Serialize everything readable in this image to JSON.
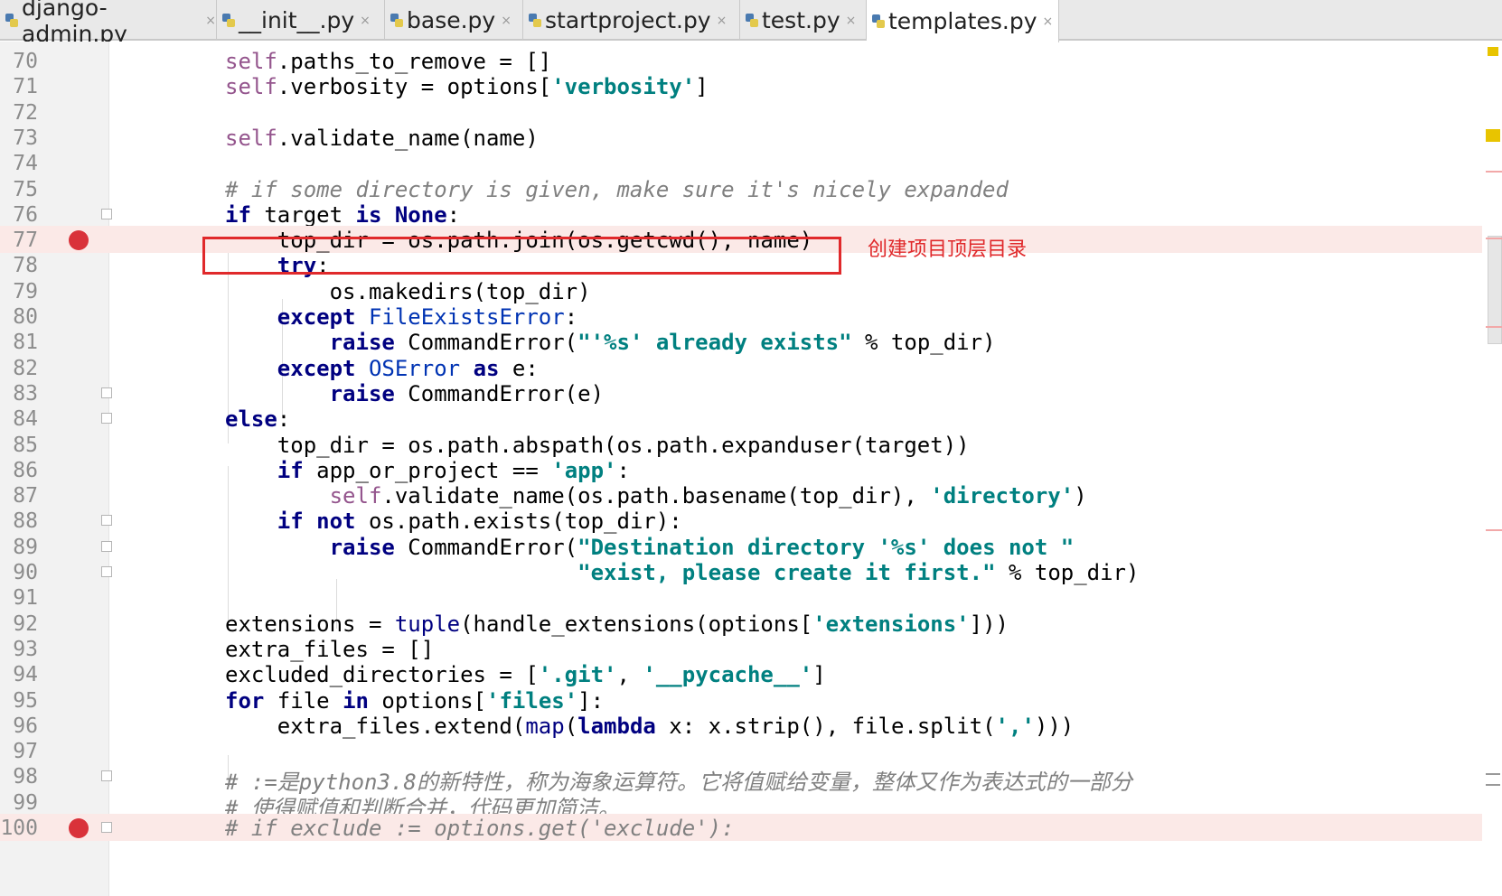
{
  "tabs": [
    {
      "label": "django-admin.py",
      "active": false
    },
    {
      "label": "__init__.py",
      "active": false
    },
    {
      "label": "base.py",
      "active": false
    },
    {
      "label": "startproject.py",
      "active": false
    },
    {
      "label": "test.py",
      "active": false
    },
    {
      "label": "templates.py",
      "active": true
    }
  ],
  "annotation": "创建项目顶层目录",
  "colors": {
    "breakpoint": "#d9323a",
    "highlight": "#e0292b",
    "keyword": "#000080",
    "string": "#008080",
    "self": "#94558d",
    "comment": "#808080"
  },
  "lines": [
    {
      "num": "70",
      "text": "self.paths_to_remove = []"
    },
    {
      "num": "71",
      "text": "self.verbosity = options['verbosity']"
    },
    {
      "num": "72",
      "text": ""
    },
    {
      "num": "73",
      "text": "self.validate_name(name)"
    },
    {
      "num": "74",
      "text": ""
    },
    {
      "num": "75",
      "text": "# if some directory is given, make sure it's nicely expanded"
    },
    {
      "num": "76",
      "text": "if target is None:"
    },
    {
      "num": "77",
      "text": "    top_dir = os.path.join(os.getcwd(), name)",
      "breakpoint": true
    },
    {
      "num": "78",
      "text": "    try:"
    },
    {
      "num": "79",
      "text": "        os.makedirs(top_dir)"
    },
    {
      "num": "80",
      "text": "    except FileExistsError:"
    },
    {
      "num": "81",
      "text": "        raise CommandError(\"'%s' already exists\" % top_dir)"
    },
    {
      "num": "82",
      "text": "    except OSError as e:"
    },
    {
      "num": "83",
      "text": "        raise CommandError(e)"
    },
    {
      "num": "84",
      "text": "else:"
    },
    {
      "num": "85",
      "text": "    top_dir = os.path.abspath(os.path.expanduser(target))"
    },
    {
      "num": "86",
      "text": "    if app_or_project == 'app':"
    },
    {
      "num": "87",
      "text": "        self.validate_name(os.path.basename(top_dir), 'directory')"
    },
    {
      "num": "88",
      "text": "    if not os.path.exists(top_dir):"
    },
    {
      "num": "89",
      "text": "        raise CommandError(\"Destination directory '%s' does not \""
    },
    {
      "num": "90",
      "text": "                           \"exist, please create it first.\" % top_dir)"
    },
    {
      "num": "91",
      "text": ""
    },
    {
      "num": "92",
      "text": "extensions = tuple(handle_extensions(options['extensions']))"
    },
    {
      "num": "93",
      "text": "extra_files = []"
    },
    {
      "num": "94",
      "text": "excluded_directories = ['.git', '__pycache__']"
    },
    {
      "num": "95",
      "text": "for file in options['files']:"
    },
    {
      "num": "96",
      "text": "    extra_files.extend(map(lambda x: x.strip(), file.split(',')))"
    },
    {
      "num": "97",
      "text": ""
    },
    {
      "num": "98",
      "text": "# :=是python3.8的新特性，称为海象运算符。它将值赋给变量，整体又作为表达式的一部分"
    },
    {
      "num": "99",
      "text": "# 使得赋值和判断合并，代码更加简洁。"
    },
    {
      "num": "100",
      "text": "# if exclude := options.get('exclude'):",
      "breakpoint": true
    }
  ]
}
